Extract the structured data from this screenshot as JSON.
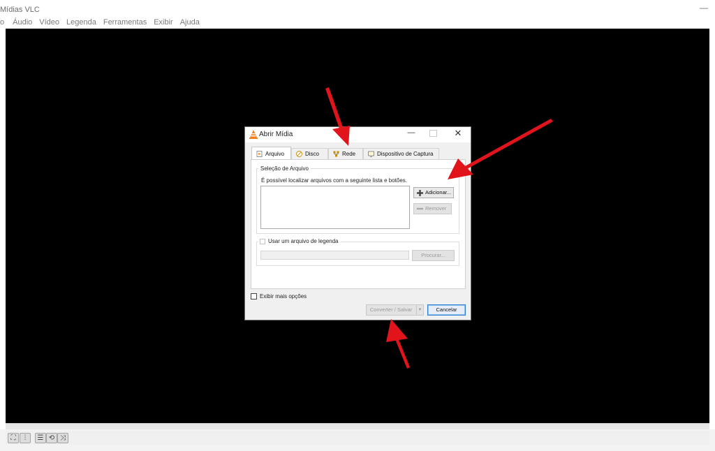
{
  "window": {
    "title": "Mídias VLC",
    "minimize": "—"
  },
  "menu": [
    "o",
    "Áudio",
    "Vídeo",
    "Legenda",
    "Ferramentas",
    "Exibir",
    "Ajuda"
  ],
  "dialog": {
    "title": "Abrir Mídia",
    "minimize": "—",
    "close": "✕",
    "tabs": [
      {
        "label": "Arquivo",
        "icon": "file-icon",
        "active": true
      },
      {
        "label": "Disco",
        "icon": "disc-icon",
        "active": false
      },
      {
        "label": "Rede",
        "icon": "network-icon",
        "active": false
      },
      {
        "label": "Dispositivo de Captura",
        "icon": "capture-device-icon",
        "active": false
      }
    ],
    "file_selection": {
      "group_label": "Seleção de Arquivo",
      "description": "É possível localizar arquivos com a seguinte lista e botões.",
      "add_button": "Adicionar...",
      "remove_button": "Remover"
    },
    "subtitle": {
      "checkbox_label": "Usar um arquivo de legenda",
      "checked": false,
      "browse_button": "Procurar..."
    },
    "more_options_label": "Exibir mais opções",
    "more_options_checked": false,
    "convert_button": "Converter / Salvar",
    "cancel_button": "Cancelar"
  },
  "controls": [
    {
      "name": "fullscreen-icon",
      "glyph": "⛶"
    },
    {
      "name": "equalizer-icon",
      "glyph": "⫶"
    },
    {
      "name": "playlist-icon",
      "glyph": "☰"
    },
    {
      "name": "loop-icon",
      "glyph": "⟲"
    },
    {
      "name": "shuffle-icon",
      "glyph": "⤨"
    }
  ],
  "colors": {
    "arrow": "#e0141a",
    "accent": "#2f7fd6",
    "vlc_cone": "#f58220"
  }
}
